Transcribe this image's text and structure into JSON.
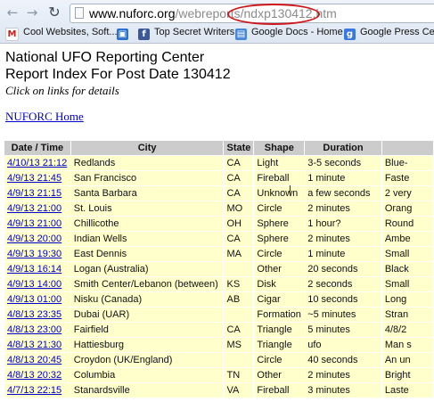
{
  "browser": {
    "url_host": "www.nuforc.org",
    "url_path": "/webreports/ndxp130412.htm",
    "bookmarks": [
      {
        "label": "Cool Websites, Soft...",
        "icon": "gmail-icon"
      },
      {
        "label": "",
        "icon": "bookmark-icon"
      },
      {
        "label": "Top Secret Writers",
        "icon": "facebook-icon"
      },
      {
        "label": "Google Docs - Home",
        "icon": "google-docs-icon"
      },
      {
        "label": "Google Press Cent",
        "icon": "google-icon"
      }
    ]
  },
  "page": {
    "title": "National UFO Reporting Center",
    "subtitle": "Report Index For Post Date 130412",
    "hint": "Click on links for details",
    "home_link": "NUFORC Home"
  },
  "table": {
    "headers": [
      "Date / Time",
      "City",
      "State",
      "Shape",
      "Duration",
      ""
    ],
    "rows": [
      {
        "date": "4/10/13 21:12",
        "city": "Redlands",
        "state": "CA",
        "shape": "Light",
        "duration": "3-5 seconds",
        "summary": "Blue-"
      },
      {
        "date": "4/9/13 21:45",
        "city": "San Francisco",
        "state": "CA",
        "shape": "Fireball",
        "duration": "1 minute",
        "summary": "Faste"
      },
      {
        "date": "4/9/13 21:15",
        "city": "Santa Barbara",
        "state": "CA",
        "shape": "Unknown",
        "duration": "a few seconds",
        "summary": "2 very"
      },
      {
        "date": "4/9/13 21:00",
        "city": "St. Louis",
        "state": "MO",
        "shape": "Circle",
        "duration": "2 minutes",
        "summary": "Orang"
      },
      {
        "date": "4/9/13 21:00",
        "city": "Chillicothe",
        "state": "OH",
        "shape": "Sphere",
        "duration": "1 hour?",
        "summary": "Round"
      },
      {
        "date": "4/9/13 20:00",
        "city": "Indian Wells",
        "state": "CA",
        "shape": "Sphere",
        "duration": "2 minutes",
        "summary": "Ambe"
      },
      {
        "date": "4/9/13 19:30",
        "city": "East Dennis",
        "state": "MA",
        "shape": "Circle",
        "duration": "1 minute",
        "summary": "Small"
      },
      {
        "date": "4/9/13 16:14",
        "city": "Logan (Australia)",
        "state": "",
        "shape": "Other",
        "duration": "20 seconds",
        "summary": "Black"
      },
      {
        "date": "4/9/13 14:00",
        "city": "Smith Center/Lebanon (between)",
        "state": "KS",
        "shape": "Disk",
        "duration": "2 seconds",
        "summary": "Small"
      },
      {
        "date": "4/9/13 01:00",
        "city": "Nisku (Canada)",
        "state": "AB",
        "shape": "Cigar",
        "duration": "10 seconds",
        "summary": "Long"
      },
      {
        "date": "4/8/13 23:35",
        "city": "Dubai (UAR)",
        "state": "",
        "shape": "Formation",
        "duration": "~5 minutes",
        "summary": "Stran"
      },
      {
        "date": "4/8/13 23:00",
        "city": "Fairfield",
        "state": "CA",
        "shape": "Triangle",
        "duration": "5 minutes",
        "summary": "4/8/2"
      },
      {
        "date": "4/8/13 21:30",
        "city": "Hattiesburg",
        "state": "MS",
        "shape": "Triangle",
        "duration": "ufo",
        "summary": "Man s"
      },
      {
        "date": "4/8/13 20:45",
        "city": "Croydon (UK/England)",
        "state": "",
        "shape": "Circle",
        "duration": "40 seconds",
        "summary": "An un"
      },
      {
        "date": "4/8/13 20:32",
        "city": "Columbia",
        "state": "TN",
        "shape": "Other",
        "duration": "2 minutes",
        "summary": "Bright"
      },
      {
        "date": "4/7/13 22:15",
        "city": "Stanardsville",
        "state": "VA",
        "shape": "Fireball",
        "duration": "3 minutes",
        "summary": "Laste"
      }
    ]
  },
  "colors": {
    "link": "#0000cc",
    "header_bg": "#cccccc",
    "row_bg": "#ffffcc",
    "annotation": "#d0151a"
  }
}
